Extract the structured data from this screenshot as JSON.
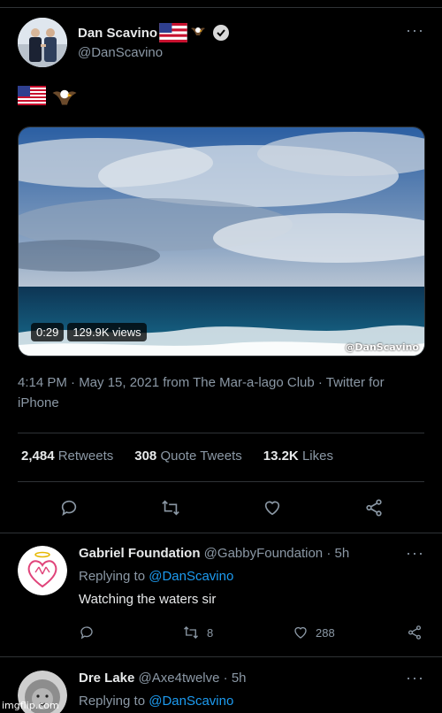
{
  "tweet": {
    "author_name": "Dan Scavino",
    "author_handle": "@DanScavino",
    "verified": true,
    "more_label": "···",
    "text_emojis": [
      "us-flag",
      "eagle"
    ],
    "media": {
      "duration": "0:29",
      "views": "129.9K views",
      "watermark": "@DanScavino"
    },
    "timestamp_line": "4:14 PM · May 15, 2021 from The Mar-a-lago Club · Twitter for iPhone",
    "stats": {
      "retweets_count": "2,484",
      "retweets_label": "Retweets",
      "quotes_count": "308",
      "quotes_label": "Quote Tweets",
      "likes_count": "13.2K",
      "likes_label": "Likes"
    },
    "actions": [
      "reply-icon",
      "retweet-icon",
      "like-icon",
      "share-icon"
    ]
  },
  "replies": [
    {
      "name": "Gabriel Foundation",
      "handle": "@GabbyFoundation",
      "time": "· 5h",
      "replying_prefix": "Replying to ",
      "replying_to": "@DanScavino",
      "text": "Watching the waters sir",
      "retweets": "8",
      "likes": "288"
    },
    {
      "name": "Dre Lake",
      "handle": "@Axe4twelve",
      "time": "· 5h",
      "replying_prefix": "Replying to ",
      "replying_to": "@DanScavino"
    }
  ],
  "watermark_site": "imgflip.com",
  "colors": {
    "background": "#000000",
    "accent": "#1d9bf0",
    "muted": "#8b98a5",
    "divider": "#2f3336"
  }
}
